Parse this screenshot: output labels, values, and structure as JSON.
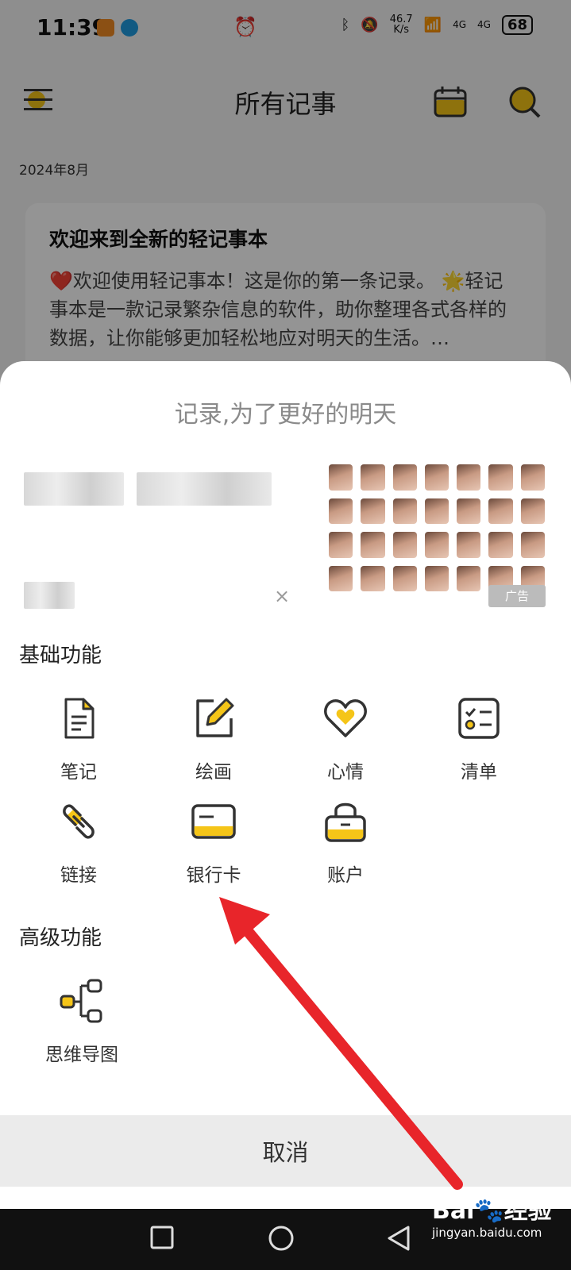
{
  "status_bar": {
    "time": "11:39",
    "net_speed_value": "46.7",
    "net_speed_unit": "K/s",
    "signal1": "4G",
    "signal2": "4G",
    "battery": "68"
  },
  "header": {
    "title": "所有记事",
    "menu_icon": "menu-icon",
    "calendar_icon": "calendar-icon",
    "search_icon": "search-icon"
  },
  "list": {
    "month": "2024年8月",
    "note": {
      "title": "欢迎来到全新的轻记事本",
      "body": "❤️欢迎使用轻记事本！这是你的第一条记录。 🌟轻记事本是一款记录繁杂信息的软件，助你整理各式各样的数据，让你能够更加轻松地应对明天的生活。…"
    }
  },
  "sheet": {
    "slogan": "记录,为了更好的明天",
    "ad": {
      "tag": "广告",
      "close": "×"
    },
    "basic_section": {
      "title": "基础功能",
      "items": [
        {
          "label": "笔记",
          "icon": "note-icon"
        },
        {
          "label": "绘画",
          "icon": "drawing-icon"
        },
        {
          "label": "心情",
          "icon": "heart-icon"
        },
        {
          "label": "清单",
          "icon": "checklist-icon"
        },
        {
          "label": "链接",
          "icon": "link-icon"
        },
        {
          "label": "银行卡",
          "icon": "card-icon"
        },
        {
          "label": "账户",
          "icon": "lock-icon"
        }
      ]
    },
    "advanced_section": {
      "title": "高级功能",
      "items": [
        {
          "label": "思维导图",
          "icon": "mindmap-icon"
        }
      ]
    },
    "cancel_label": "取消"
  },
  "watermark": {
    "brand": "Bai",
    "brand_cn": "经验",
    "url": "jingyan.baidu.com"
  },
  "colors": {
    "accent_yellow": "#F5C518",
    "annotation_red": "#E8252A",
    "nav_bar": "#111111"
  }
}
